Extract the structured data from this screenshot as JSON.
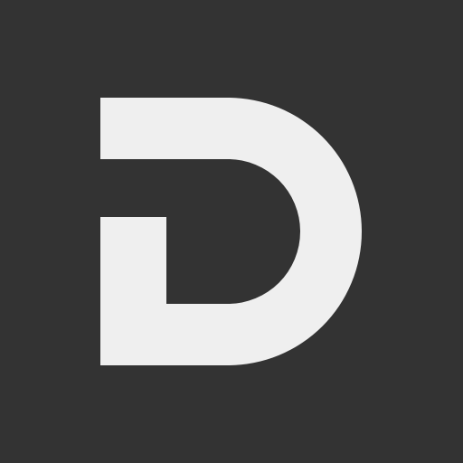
{
  "icon": {
    "logo_name": "d-logo-icon",
    "background_color": "#333333",
    "logo_color": "#efefef"
  }
}
